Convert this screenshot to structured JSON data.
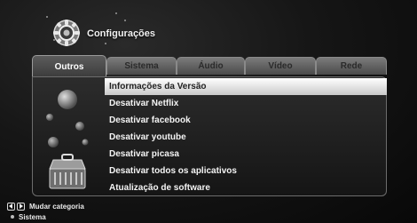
{
  "header": {
    "title": "Configurações",
    "icon": "gear-icon"
  },
  "tabs": [
    {
      "label": "Outros",
      "active": true
    },
    {
      "label": "Sistema",
      "active": false
    },
    {
      "label": "Áudio",
      "active": false
    },
    {
      "label": "Vídeo",
      "active": false
    },
    {
      "label": "Rede",
      "active": false
    }
  ],
  "menu": {
    "items": [
      {
        "label": "Informações da Versão",
        "selected": true
      },
      {
        "label": "Desativar Netflix",
        "selected": false
      },
      {
        "label": "Desativar facebook",
        "selected": false
      },
      {
        "label": "Desativar youtube",
        "selected": false
      },
      {
        "label": "Desativar picasa",
        "selected": false
      },
      {
        "label": "Desativar todos os aplicativos",
        "selected": false
      },
      {
        "label": "Atualização de software",
        "selected": false
      }
    ]
  },
  "footer": {
    "hint": "Mudar categoria",
    "current": "Sistema",
    "left_icon": "left-arrow-button-icon",
    "right_icon": "right-arrow-button-icon"
  },
  "colors": {
    "selected_bg": "#ffffff",
    "background": "#111111",
    "tab_inactive": "#6a6a6a"
  },
  "side_art_icon": "toolbox-icon"
}
